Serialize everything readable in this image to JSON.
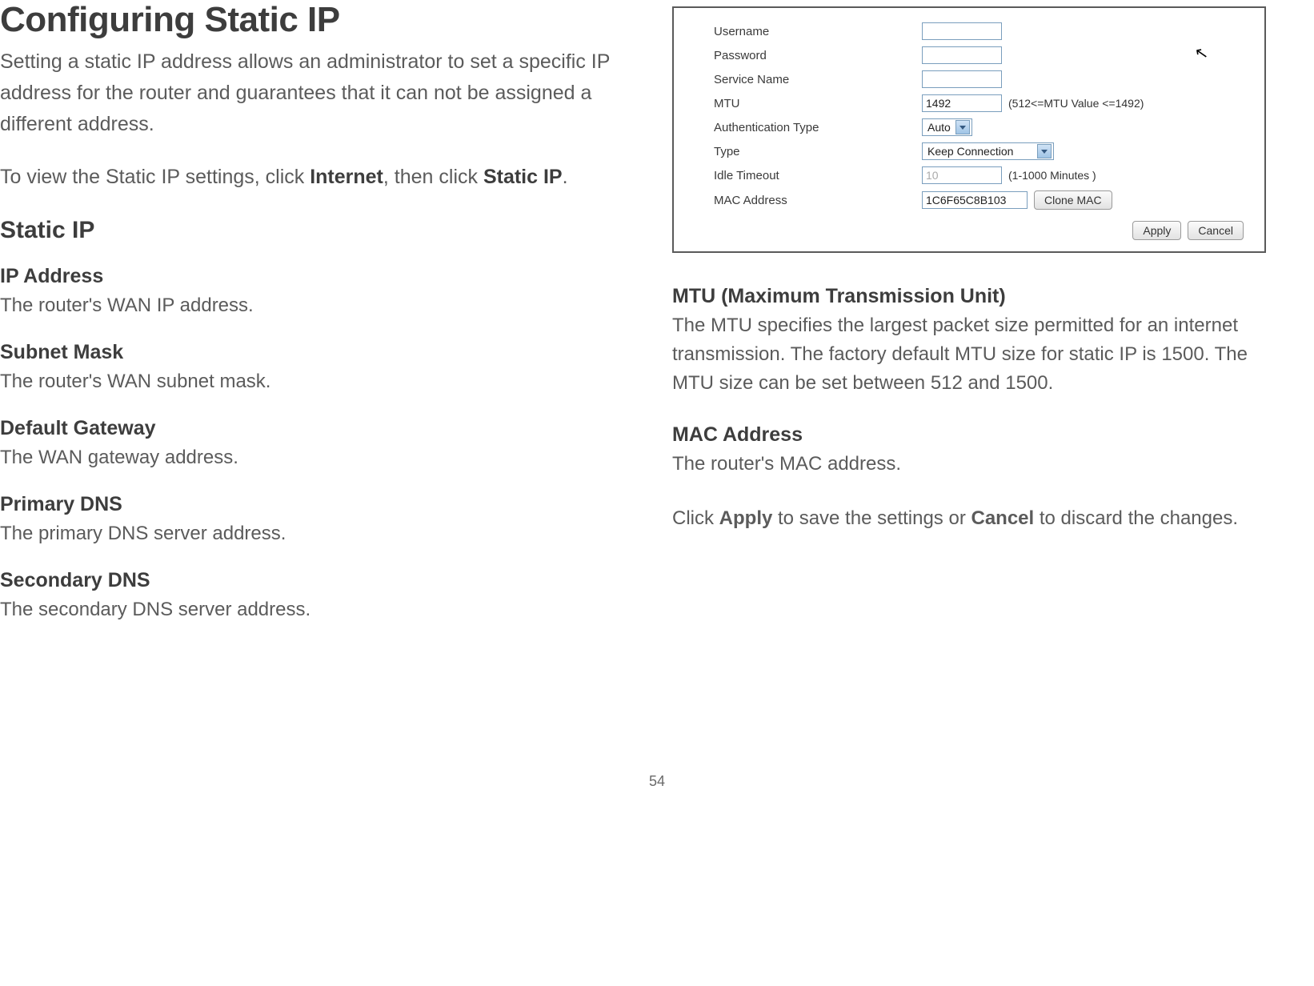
{
  "left": {
    "title": "Configuring Static IP",
    "intro": "Setting a static IP address allows an administrator to set a specific IP address for the router and guarantees that it can not be assigned a different address.",
    "nav_pre": "To view the Static IP settings, click ",
    "nav_b1": "Internet",
    "nav_mid": ", then click ",
    "nav_b2": "Static IP",
    "nav_post": ".",
    "section": "Static IP",
    "fields": [
      {
        "title": "IP Address",
        "desc": "The router's WAN IP address."
      },
      {
        "title": "Subnet Mask",
        "desc": "The router's WAN subnet mask."
      },
      {
        "title": "Default Gateway",
        "desc": "The WAN gateway address."
      },
      {
        "title": "Primary DNS",
        "desc": "The primary DNS server address."
      },
      {
        "title": "Secondary DNS",
        "desc": "The secondary DNS server address."
      }
    ]
  },
  "panel": {
    "rows": {
      "username_label": "Username",
      "username_value": "",
      "password_label": "Password",
      "password_value": "",
      "service_label": "Service Name",
      "service_value": "",
      "mtu_label": "MTU",
      "mtu_value": "1492",
      "mtu_hint": "(512<=MTU Value <=1492)",
      "auth_label": "Authentication Type",
      "auth_value": "Auto",
      "type_label": "Type",
      "type_value": "Keep Connection",
      "idle_label": "Idle Timeout",
      "idle_value": "10",
      "idle_hint": "(1-1000 Minutes )",
      "mac_label": "MAC Address",
      "mac_value": "1C6F65C8B103",
      "clone_btn": "Clone MAC"
    },
    "apply": "Apply",
    "cancel": "Cancel"
  },
  "right": {
    "mtu_title": "MTU (Maximum Transmission Unit)",
    "mtu_desc": "The MTU specifies the largest packet size permitted for an internet transmission. The factory default MTU size for static IP is 1500. The MTU size can be set between 512 and 1500.",
    "mac_title": "MAC Address",
    "mac_desc": "The router's MAC address.",
    "apply_pre": "Click ",
    "apply_b1": "Apply",
    "apply_mid": " to save the settings or ",
    "apply_b2": "Cancel",
    "apply_post": " to discard the changes."
  },
  "page_number": "54"
}
